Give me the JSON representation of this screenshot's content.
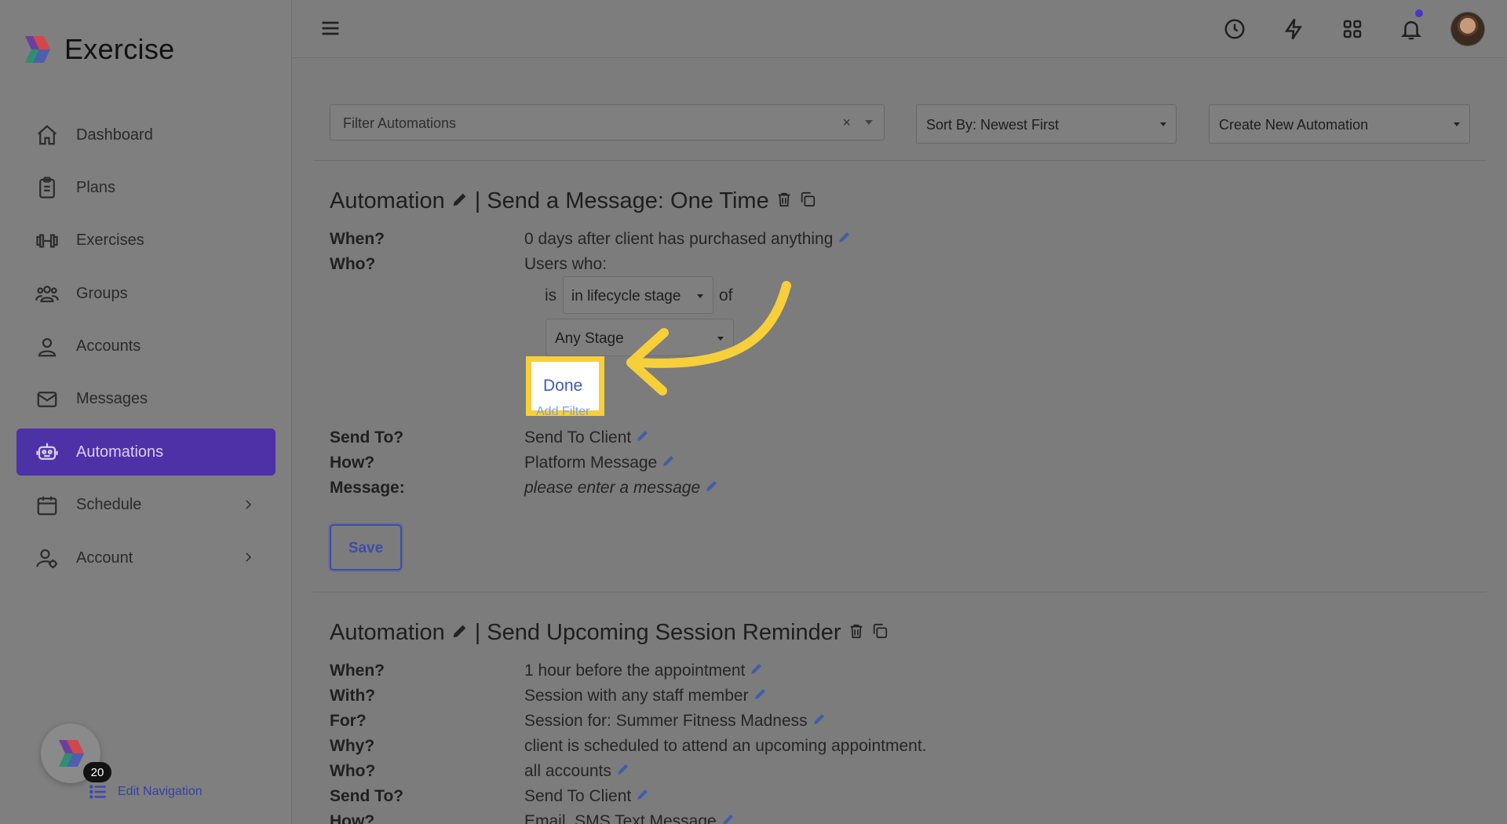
{
  "app": {
    "name": "Exercise"
  },
  "sidebar": {
    "items": [
      {
        "label": "Dashboard",
        "icon": "home-icon"
      },
      {
        "label": "Plans",
        "icon": "clipboard-icon"
      },
      {
        "label": "Exercises",
        "icon": "dumbbell-icon"
      },
      {
        "label": "Groups",
        "icon": "users-icon"
      },
      {
        "label": "Accounts",
        "icon": "user-icon"
      },
      {
        "label": "Messages",
        "icon": "envelope-icon"
      },
      {
        "label": "Automations",
        "icon": "robot-icon",
        "active": true
      },
      {
        "label": "Schedule",
        "icon": "calendar-icon",
        "has_chevron": true
      },
      {
        "label": "Account",
        "icon": "user-gear-icon",
        "has_chevron": true
      }
    ],
    "badge_count": "20",
    "edit_nav_label": "Edit Navigation"
  },
  "topbar": {
    "icons": [
      "clock-icon",
      "lightning-icon",
      "apps-grid-icon",
      "bell-icon"
    ],
    "accent_color": "#4a36c9"
  },
  "toolbar": {
    "filter_placeholder": "Filter Automations",
    "clear_symbol": "×",
    "sort_label": "Sort By: Newest First",
    "create_label": "Create New Automation"
  },
  "automation1": {
    "title_prefix": "Automation",
    "title_sep": "|",
    "title": "Send a Message: One Time",
    "when_label": "When?",
    "when_value": "0 days after client has purchased anything",
    "who_label": "Who?",
    "who_value": "Users who:",
    "is_text": "is",
    "lifecycle_select": "in lifecycle stage",
    "of_text": "of",
    "stage_select": "Any Stage",
    "done_label": "Done",
    "add_filter_label": "Add Filter",
    "sendto_label": "Send To?",
    "sendto_value": "Send To Client",
    "how_label": "How?",
    "how_value": "Platform Message",
    "message_label": "Message:",
    "message_value": "please enter a message",
    "save_label": "Save"
  },
  "automation2": {
    "title_prefix": "Automation",
    "title_sep": "|",
    "title": "Send Upcoming Session Reminder",
    "when_label": "When?",
    "when_value": "1 hour before the appointment",
    "with_label": "With?",
    "with_value": "Session with any staff member",
    "for_label": "For?",
    "for_value": "Session for: Summer Fitness Madness",
    "why_label": "Why?",
    "why_value": "client is scheduled to attend an upcoming appointment.",
    "who_label": "Who?",
    "who_value": "all accounts",
    "sendto_label": "Send To?",
    "sendto_value": "Send To Client",
    "how_label": "How?",
    "how_value": "Email, SMS Text Message"
  },
  "colors": {
    "active_nav": "#4d31a7",
    "highlight": "#f7cf3b",
    "link": "#3b5bbf"
  }
}
